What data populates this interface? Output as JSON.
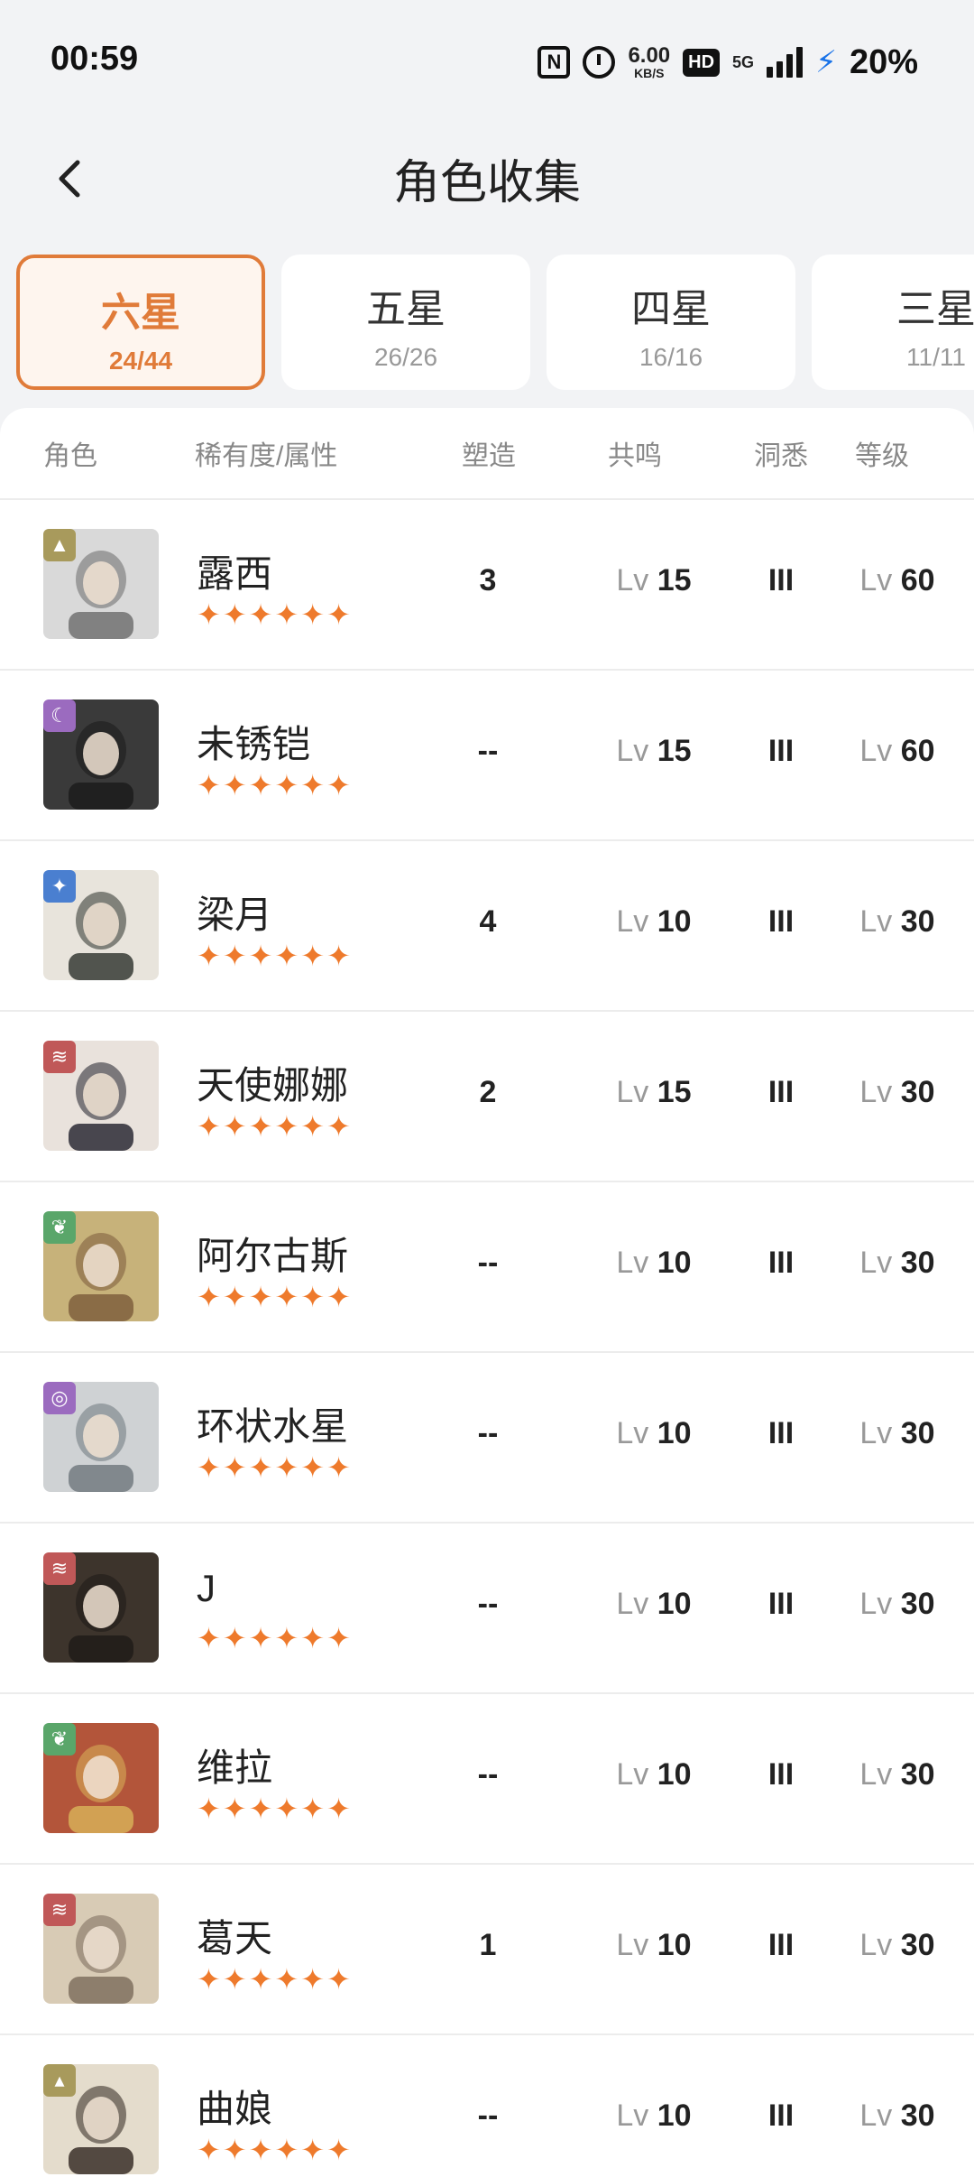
{
  "status_bar": {
    "time": "00:59",
    "speed_value": "6.00",
    "speed_unit": "KB/S",
    "hd": "HD",
    "network": "5G",
    "battery": "20%",
    "charging_color": "#1a73e8"
  },
  "header": {
    "title": "角色收集",
    "back_icon": "chevron-left-icon"
  },
  "tabs": [
    {
      "label": "六星",
      "count": "24/44",
      "active": true
    },
    {
      "label": "五星",
      "count": "26/26",
      "active": false
    },
    {
      "label": "四星",
      "count": "16/16",
      "active": false
    },
    {
      "label": "三星",
      "count": "11/11",
      "active": false
    }
  ],
  "accent_color": "#e07b39",
  "table": {
    "headers": {
      "character": "角色",
      "rarity": "稀有度/属性",
      "shape": "塑造",
      "resonance": "共鸣",
      "insight": "洞悉",
      "level": "等级"
    },
    "lv_prefix": "Lv",
    "rows": [
      {
        "name": "露西",
        "stars": "✦✦✦✦✦✦",
        "shape": "3",
        "resonance": "15",
        "insight": "III",
        "level": "60",
        "element_icon": "triangle-icon",
        "element_color": "#a89a5c"
      },
      {
        "name": "未锈铠",
        "stars": "✦✦✦✦✦✦",
        "shape": "--",
        "resonance": "15",
        "insight": "III",
        "level": "60",
        "element_icon": "moon-icon",
        "element_color": "#9b6bbf"
      },
      {
        "name": "梁月",
        "stars": "✦✦✦✦✦✦",
        "shape": "4",
        "resonance": "10",
        "insight": "III",
        "level": "30",
        "element_icon": "star-icon",
        "element_color": "#4a7fd0"
      },
      {
        "name": "天使娜娜",
        "stars": "✦✦✦✦✦✦",
        "shape": "2",
        "resonance": "15",
        "insight": "III",
        "level": "30",
        "element_icon": "claw-icon",
        "element_color": "#c05858"
      },
      {
        "name": "阿尔古斯",
        "stars": "✦✦✦✦✦✦",
        "shape": "--",
        "resonance": "10",
        "insight": "III",
        "level": "30",
        "element_icon": "leaf-icon",
        "element_color": "#5aa66a"
      },
      {
        "name": "环状水星",
        "stars": "✦✦✦✦✦✦",
        "shape": "--",
        "resonance": "10",
        "insight": "III",
        "level": "30",
        "element_icon": "ring-icon",
        "element_color": "#9b6bbf"
      },
      {
        "name": "J",
        "stars": "✦✦✦✦✦✦",
        "shape": "--",
        "resonance": "10",
        "insight": "III",
        "level": "30",
        "element_icon": "claw-icon",
        "element_color": "#c05858"
      },
      {
        "name": "维拉",
        "stars": "✦✦✦✦✦✦",
        "shape": "--",
        "resonance": "10",
        "insight": "III",
        "level": "30",
        "element_icon": "leaf-icon",
        "element_color": "#5aa66a"
      },
      {
        "name": "葛天",
        "stars": "✦✦✦✦✦✦",
        "shape": "1",
        "resonance": "10",
        "insight": "III",
        "level": "30",
        "element_icon": "claw-icon",
        "element_color": "#c05858"
      },
      {
        "name": "曲娘",
        "stars": "✦✦✦✦✦✦",
        "shape": "--",
        "resonance": "10",
        "insight": "III",
        "level": "30",
        "element_icon": "rock-icon",
        "element_color": "#a89a5c"
      }
    ]
  }
}
